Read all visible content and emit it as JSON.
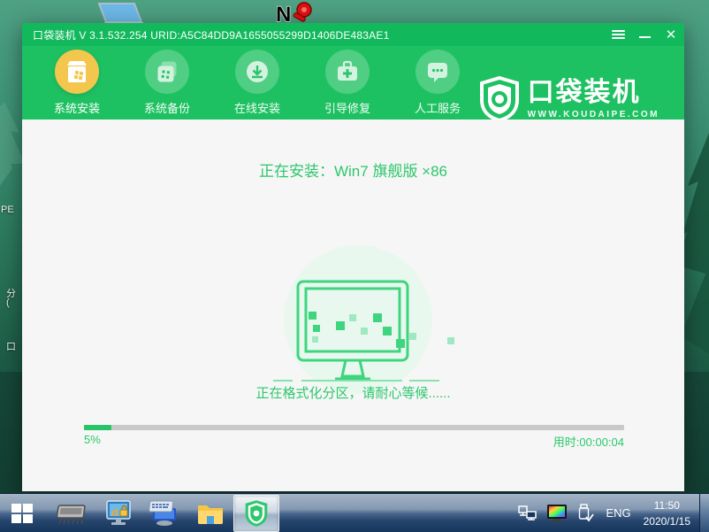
{
  "desktop": {
    "partial_icon_labels": {
      "a": "PE",
      "b": "分",
      "c": "(",
      "d": "口"
    },
    "icons": [
      "laptop-shortcut-icon",
      "n-key-shortcut-icon"
    ]
  },
  "window": {
    "titlebar": {
      "title": "口袋装机 V 3.1.532.254 URID:A5C84DD9A1655055299D1406DE483AE1",
      "buttons": [
        "menu-icon",
        "minimize-icon",
        "close-icon"
      ]
    },
    "nav": {
      "items": [
        {
          "label": "系统安装",
          "icon": "install-box-icon",
          "active": true
        },
        {
          "label": "系统备份",
          "icon": "backup-windows-icon",
          "active": false
        },
        {
          "label": "在线安装",
          "icon": "download-circle-icon",
          "active": false
        },
        {
          "label": "引导修复",
          "icon": "repair-kit-icon",
          "active": false
        },
        {
          "label": "人工服务",
          "icon": "chat-bubble-icon",
          "active": false
        }
      ]
    },
    "brand": {
      "name": "口袋装机",
      "url": "WWW.KOUDAIPE.COM",
      "icon": "shield-logo-icon"
    },
    "main": {
      "heading": "正在安装：Win7 旗舰版 ×86",
      "illustration": "monitor-install-illustration",
      "status": "正在格式化分区，请耐心等候......",
      "progress": {
        "percent": 5,
        "percent_label": "5%",
        "elapsed_label": "用时:00:00:04"
      }
    }
  },
  "taskbar": {
    "start": "windows-start-icon",
    "pinned": [
      "memory-chip-icon",
      "partition-tool-icon",
      "onscreen-keyboard-icon",
      "file-explorer-icon",
      "pocket-installer-shield-icon"
    ],
    "active_app": "pocket-installer-shield-icon",
    "tray": {
      "icons": [
        "network-icon",
        "display-color-icon",
        "usb-icon"
      ],
      "language": "ENG",
      "time": "11:50",
      "date": "2020/1/15"
    }
  },
  "colors": {
    "titlebar_green": "#12b95c",
    "band_green": "#1ec162",
    "accent_green": "#2dc76d",
    "active_nav_yellow": "#f3c64d",
    "progress_track": "#c9c9c9",
    "content_bg": "#f5f6f5",
    "taskbar_navy": "#16355c"
  }
}
